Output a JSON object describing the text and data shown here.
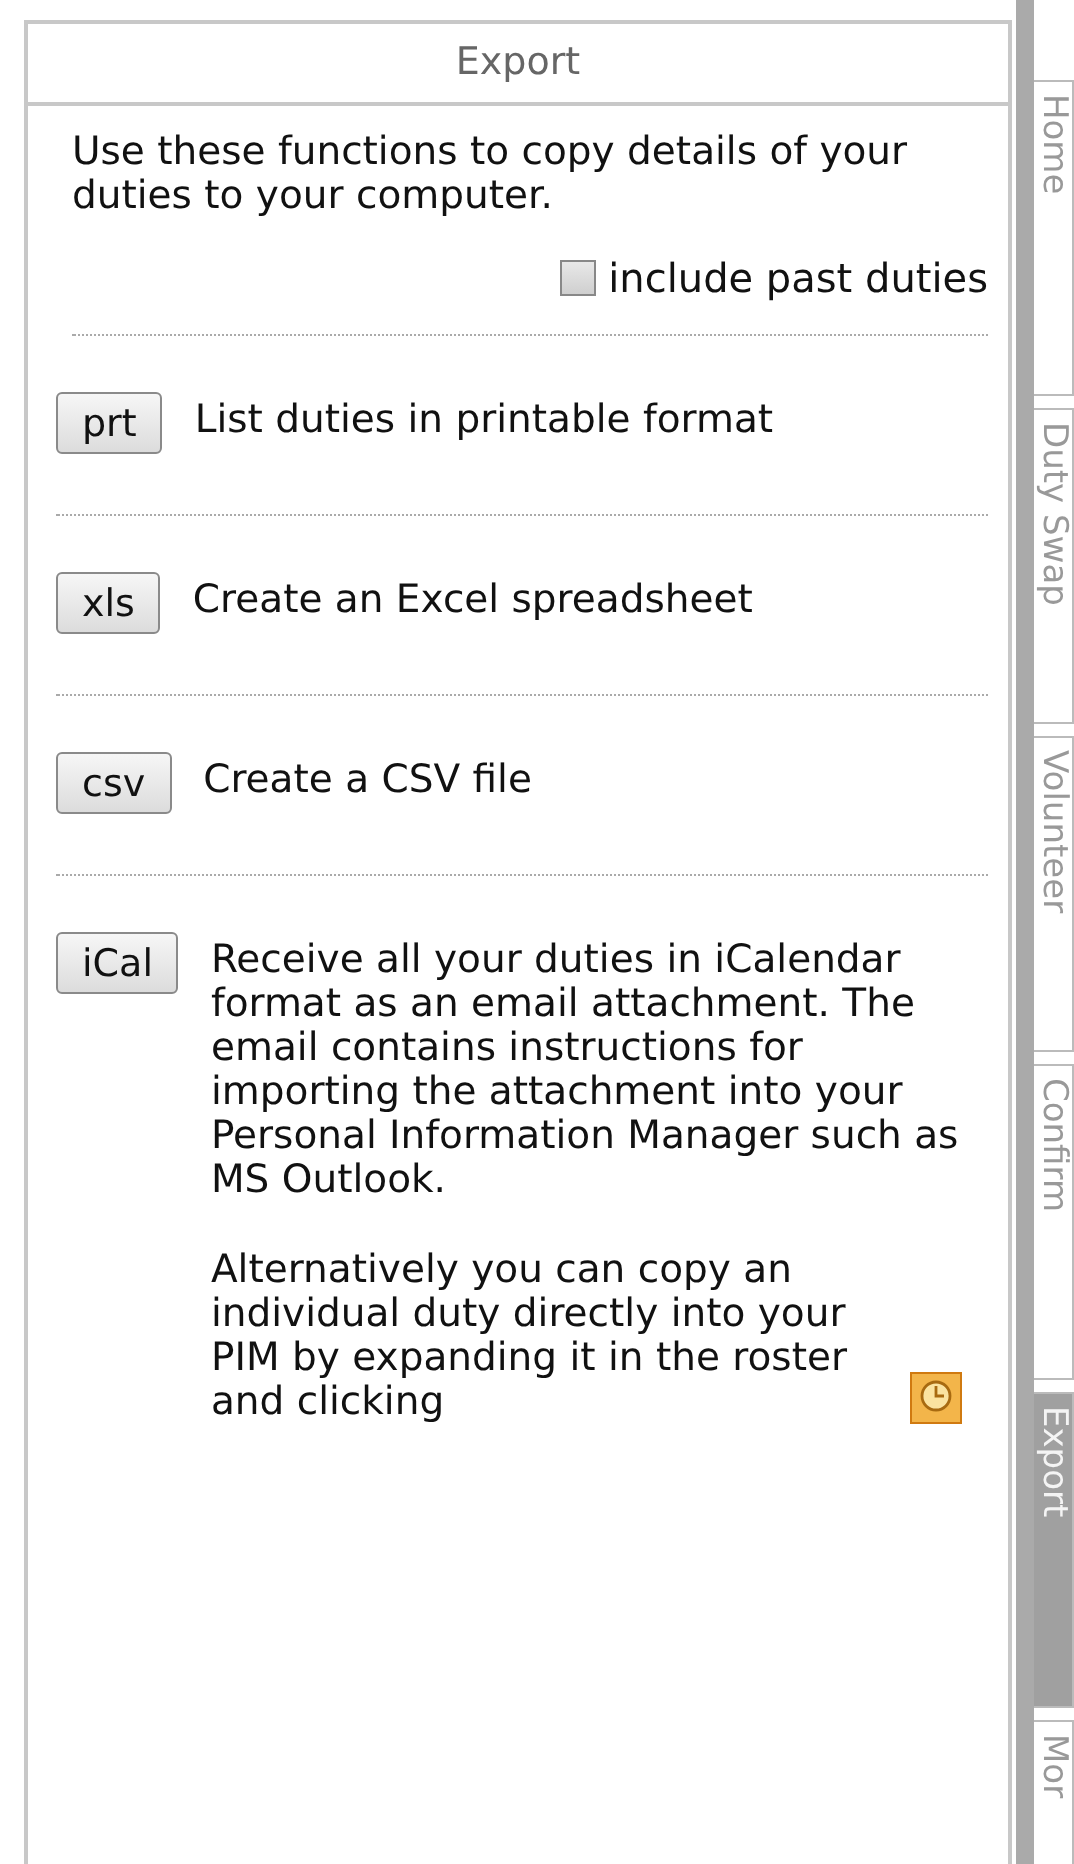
{
  "panel": {
    "title": "Export",
    "intro": "Use these functions to copy details of your duties to your computer.",
    "include_past": {
      "label": "include past duties",
      "checked": false
    }
  },
  "actions": [
    {
      "button": "prt",
      "paragraphs": [
        "List duties in printable format"
      ]
    },
    {
      "button": "xls",
      "paragraphs": [
        "Create an Excel spreadsheet"
      ]
    },
    {
      "button": "csv",
      "paragraphs": [
        "Create a CSV file"
      ]
    },
    {
      "button": "iCal",
      "paragraphs": [
        "Receive all your duties in iCalendar format as an email attachment.  The email contains instructions for importing the attachment into your Personal Information Manager such as MS Outlook.",
        "Alternatively you can copy an individual duty directly into your PIM by expanding it in the roster and clicking"
      ],
      "trailing_icon": true
    }
  ],
  "side_tabs": [
    {
      "label": "Home",
      "selected": false
    },
    {
      "label": "Duty Swap",
      "selected": false
    },
    {
      "label": "Volunteer",
      "selected": false
    },
    {
      "label": "Confirm",
      "selected": false
    },
    {
      "label": "Export",
      "selected": true
    },
    {
      "label": "Mor",
      "selected": false
    }
  ]
}
